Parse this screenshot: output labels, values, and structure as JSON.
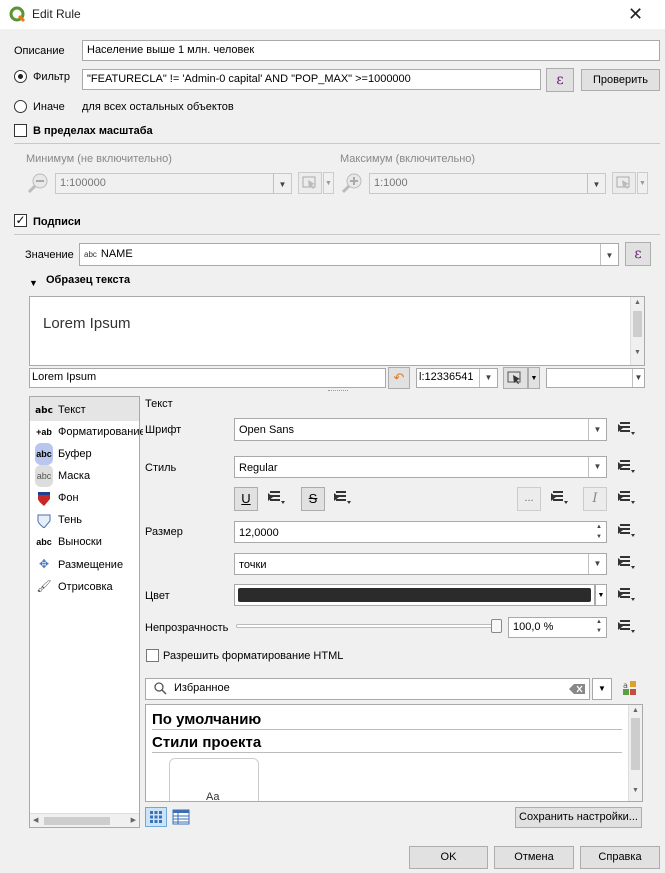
{
  "window": {
    "title": "Edit Rule"
  },
  "rule": {
    "description_label": "Описание",
    "description_value": "Население выше 1 млн. человек",
    "filter_label": "Фильтр",
    "filter_value": "\"FEATURECLA\" != 'Admin-0 capital' AND  \"POP_MAX\" >=1000000",
    "check_button": "Проверить",
    "else_label": "Иначе",
    "else_desc": "для всех остальных объектов"
  },
  "scale": {
    "title": "В пределах масштаба",
    "min_label": "Минимум (не включительно)",
    "min_value": "1:100000",
    "max_label": "Максимум (включительно)",
    "max_value": "1:1000"
  },
  "labels": {
    "title": "Подписи",
    "value_label": "Значение",
    "value_type": "abc",
    "value": "NAME",
    "sample_title": "Образец текста",
    "sample_text": "Lorem Ipsum",
    "sample_input": "Lorem Ipsum",
    "sample_scale": "l:12336541"
  },
  "sidebar": {
    "items": [
      {
        "label": "Текст",
        "icon": "abc"
      },
      {
        "label": "Форматирование",
        "icon": "+ab"
      },
      {
        "label": "Буфер",
        "icon": "abc"
      },
      {
        "label": "Маска",
        "icon": "abc"
      },
      {
        "label": "Фон",
        "icon": "shield"
      },
      {
        "label": "Тень",
        "icon": "shadow"
      },
      {
        "label": "Выноски",
        "icon": "abc"
      },
      {
        "label": "Размещение",
        "icon": "arrows"
      },
      {
        "label": "Отрисовка",
        "icon": "brush"
      }
    ]
  },
  "text": {
    "section_title": "Текст",
    "font_label": "Шрифт",
    "font_value": "Open Sans",
    "style_label": "Стиль",
    "style_value": "Regular",
    "underline": "U",
    "strike": "S",
    "italic": "I",
    "ellipsis": "...",
    "size_label": "Размер",
    "size_value": "12,0000",
    "unit_value": "точки",
    "color_label": "Цвет",
    "color_hex": "#2b2b2b",
    "opacity_label": "Непрозрачность",
    "opacity_value": "100,0 %",
    "opacity_fraction": 1.0,
    "html_label": "Разрешить форматирование HTML",
    "search_placeholder": "Избранное",
    "style_default": "По умолчанию",
    "style_project": "Стили проекта",
    "preview_text": "Aa",
    "save_settings": "Сохранить настройки..."
  },
  "footer": {
    "ok": "OK",
    "cancel": "Отмена",
    "help": "Справка"
  },
  "colors": {
    "accent": "#6a1b78",
    "qgis_green": "#589632",
    "qgis_yellow": "#ee7913",
    "selection": "#e5e5e5"
  }
}
